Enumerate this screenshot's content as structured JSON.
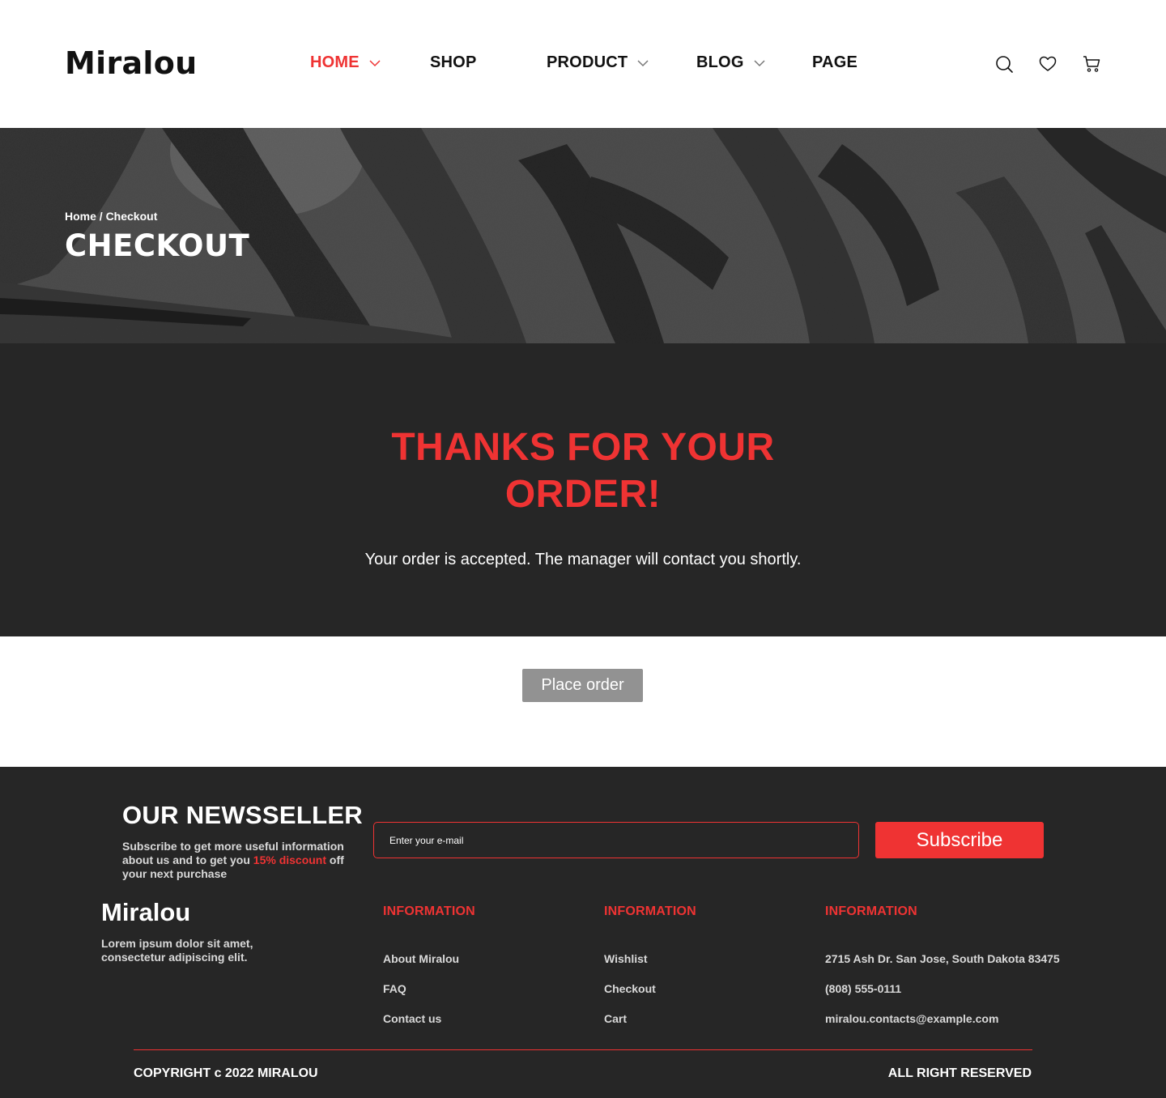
{
  "brand": {
    "logo": "Miralou",
    "accent": "#ef3333"
  },
  "nav": {
    "items": [
      {
        "label": "HOME",
        "active": true,
        "has_dropdown": true
      },
      {
        "label": "SHOP",
        "active": false,
        "has_dropdown": false
      },
      {
        "label": "PRODUCT",
        "active": false,
        "has_dropdown": true
      },
      {
        "label": "BLOG",
        "active": false,
        "has_dropdown": true
      },
      {
        "label": "PAGE",
        "active": false,
        "has_dropdown": false
      }
    ],
    "icons": [
      "search-icon",
      "heart-icon",
      "cart-icon"
    ]
  },
  "hero": {
    "breadcrumb": "Home / Checkout",
    "title": "CHECKOUT"
  },
  "thanks": {
    "title": "THANKS FOR YOUR ORDER!",
    "message": "Your order is accepted. The manager will contact you shortly."
  },
  "place_order": {
    "label": "Place order"
  },
  "newsletter": {
    "title": "OUR NEWSSELLER",
    "text_before": "Subscribe to get more useful information about us and to get you ",
    "highlight": "15% discount",
    "text_after": " off your next purchase",
    "placeholder": "Enter your e-mail",
    "button": "Subscribe"
  },
  "footer": {
    "logo": "Miralou",
    "description": "Lorem ipsum dolor sit amet, consectetur adipiscing elit.",
    "columns": [
      {
        "title": "INFORMATION",
        "items": [
          "About Miralou",
          "FAQ",
          "Contact us"
        ]
      },
      {
        "title": "INFORMATION",
        "items": [
          "Wishlist",
          "Checkout",
          "Cart"
        ]
      },
      {
        "title": "INFORMATION",
        "items": [
          "2715 Ash Dr. San Jose, South Dakota 83475",
          "(808) 555-0111",
          "miralou.contacts@example.com"
        ]
      }
    ],
    "copyright": "COPYRIGHT c 2022 MIRALOU",
    "rights": "ALL RIGHT RESERVED"
  }
}
